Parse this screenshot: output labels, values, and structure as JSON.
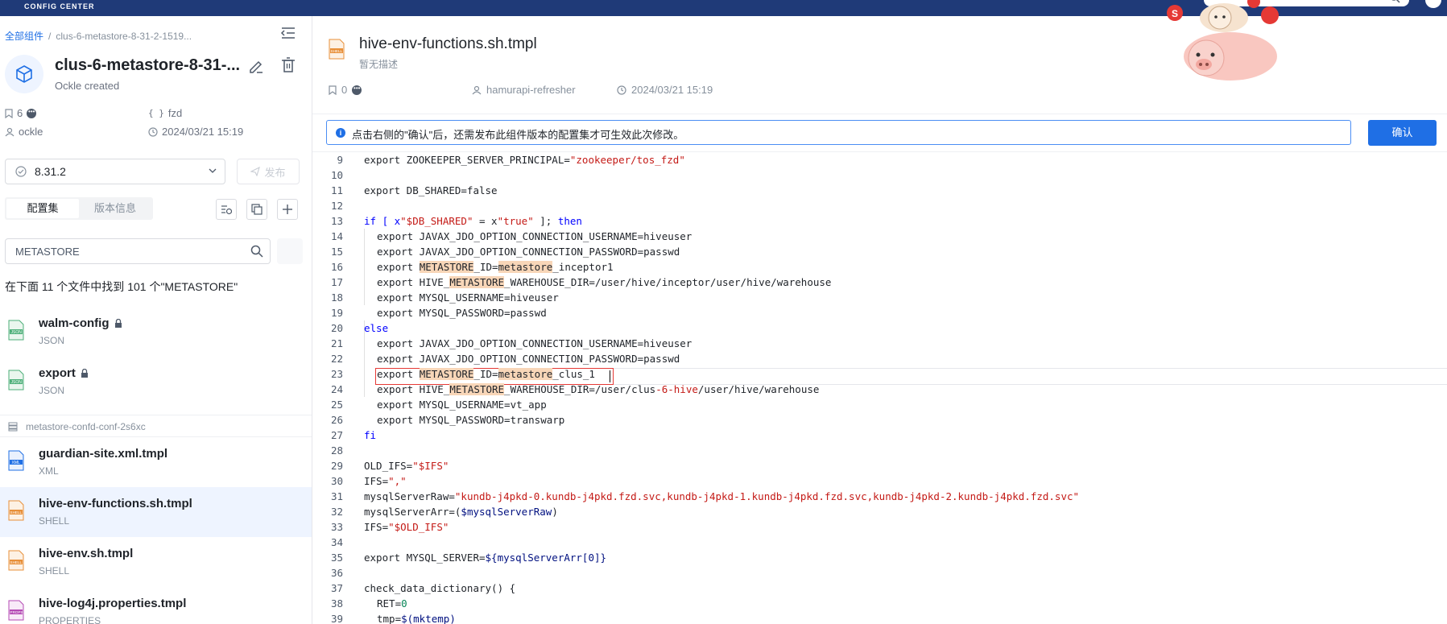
{
  "header": {
    "brand": "CONFIG CENTER"
  },
  "breadcrumb": {
    "root": "全部组件",
    "separator": "/",
    "current": "clus-6-metastore-8-31-2-1519..."
  },
  "component": {
    "title": "clus-6-metastore-8-31-...",
    "subtitle": "Ockle created",
    "bookmarks": "6",
    "namespace": "fzd",
    "owner": "ockle",
    "created": "2024/03/21 15:19"
  },
  "version": {
    "selected": "8.31.2",
    "publish_label": "发布"
  },
  "tabs": {
    "config": "配置集",
    "version_info": "版本信息"
  },
  "search": {
    "value": "METASTORE",
    "summary": "在下面 11 个文件中找到 101 个\"METASTORE\""
  },
  "files": [
    {
      "name": "walm-config",
      "type": "JSON",
      "locked": true,
      "icon": "JSON"
    },
    {
      "name": "export",
      "type": "JSON",
      "locked": true,
      "icon": "JSON"
    }
  ],
  "group": {
    "label": "metastore-confd-conf-2s6xc"
  },
  "group_files": [
    {
      "name": "guardian-site.xml.tmpl",
      "type": "XML",
      "icon": "XML"
    },
    {
      "name": "hive-env-functions.sh.tmpl",
      "type": "SHELL",
      "icon": "SHELL",
      "active": true
    },
    {
      "name": "hive-env.sh.tmpl",
      "type": "SHELL",
      "icon": "SHELL"
    },
    {
      "name": "hive-log4j.properties.tmpl",
      "type": "PROPERTIES",
      "icon": "PROPS"
    }
  ],
  "file_header": {
    "title": "hive-env-functions.sh.tmpl",
    "description": "暂无描述",
    "bookmarks": "0",
    "updater": "hamurapi-refresher",
    "updated": "2024/03/21 15:19",
    "icon": "SHELL"
  },
  "notice": {
    "text": "点击右侧的\"确认\"后，还需发布此组件版本的配置集才可生效此次修改。",
    "confirm_label": "确认"
  },
  "colors": {
    "accent": "#1f6fe5",
    "topbar": "#1f3a78",
    "highlight": "#f8d6b8",
    "string": "#c41a16",
    "error_box": "#e53935"
  },
  "code_lines": [
    {
      "n": "9"
    },
    {
      "n": "10"
    },
    {
      "n": "11"
    },
    {
      "n": "12"
    },
    {
      "n": "13"
    },
    {
      "n": "14"
    },
    {
      "n": "15"
    },
    {
      "n": "16"
    },
    {
      "n": "17"
    },
    {
      "n": "18"
    },
    {
      "n": "19"
    },
    {
      "n": "20"
    },
    {
      "n": "21"
    },
    {
      "n": "22"
    },
    {
      "n": "23"
    },
    {
      "n": "24"
    },
    {
      "n": "25"
    },
    {
      "n": "26"
    },
    {
      "n": "27"
    },
    {
      "n": "28"
    },
    {
      "n": "29"
    },
    {
      "n": "30"
    },
    {
      "n": "31"
    },
    {
      "n": "32"
    },
    {
      "n": "33"
    },
    {
      "n": "34"
    },
    {
      "n": "35"
    },
    {
      "n": "36"
    },
    {
      "n": "37"
    },
    {
      "n": "38"
    },
    {
      "n": "39"
    }
  ],
  "code": {
    "l9": [
      "export ZOOKEEPER_SERVER_PRINCIPAL=",
      "\"zookeeper/tos_fzd\""
    ],
    "l11": "export DB_SHARED=false",
    "l13": [
      "if [ x",
      "\"$DB_SHARED\"",
      " = x",
      "\"true\"",
      " ]; ",
      "then"
    ],
    "l14": "export JAVAX_JDO_OPTION_CONNECTION_USERNAME=hiveuser",
    "l15": "export JAVAX_JDO_OPTION_CONNECTION_PASSWORD=passwd",
    "l16": [
      "export ",
      "METASTORE",
      "_ID=",
      "metastore",
      "_inceptor1"
    ],
    "l17": [
      "export HIVE_",
      "METASTORE",
      "_WAREHOUSE_DIR=/user/hive/inceptor/user/hive/warehouse"
    ],
    "l18": "export MYSQL_USERNAME=hiveuser",
    "l19": "export MYSQL_PASSWORD=passwd",
    "l20": "else",
    "l21": "export JAVAX_JDO_OPTION_CONNECTION_USERNAME=hiveuser",
    "l22": "export JAVAX_JDO_OPTION_CONNECTION_PASSWORD=passwd",
    "l23": [
      "export ",
      "METASTORE",
      "_ID=",
      "metastore",
      "_clus_1"
    ],
    "l24": [
      "export HIVE_",
      "METASTORE",
      "_WAREHOUSE_DIR=/user/clus",
      "-6-hive",
      "/user/hive/warehouse"
    ],
    "l25": "export MYSQL_USERNAME=vt_app",
    "l26": "export MYSQL_PASSWORD=transwarp",
    "l27": "fi",
    "l29": [
      "OLD_IFS=",
      "\"$IFS\""
    ],
    "l30": [
      "IFS=",
      "\",\""
    ],
    "l31": [
      "mysqlServerRaw=",
      "\"kundb-j4pkd-0.kundb-j4pkd.fzd.svc,kundb-j4pkd-1.kundb-j4pkd.fzd.svc,kundb-j4pkd-2.kundb-j4pkd.fzd.svc\""
    ],
    "l32": [
      "mysqlServerArr=(",
      "$mysqlServerRaw",
      ")"
    ],
    "l33": [
      "IFS=",
      "\"$OLD_IFS\""
    ],
    "l35": [
      "export MYSQL_SERVER=",
      "${mysqlServerArr[0]}"
    ],
    "l37": "check_data_dictionary() {",
    "l38": [
      "RET=",
      "0"
    ],
    "l39": [
      "tmp=",
      "$(mktemp)"
    ]
  }
}
